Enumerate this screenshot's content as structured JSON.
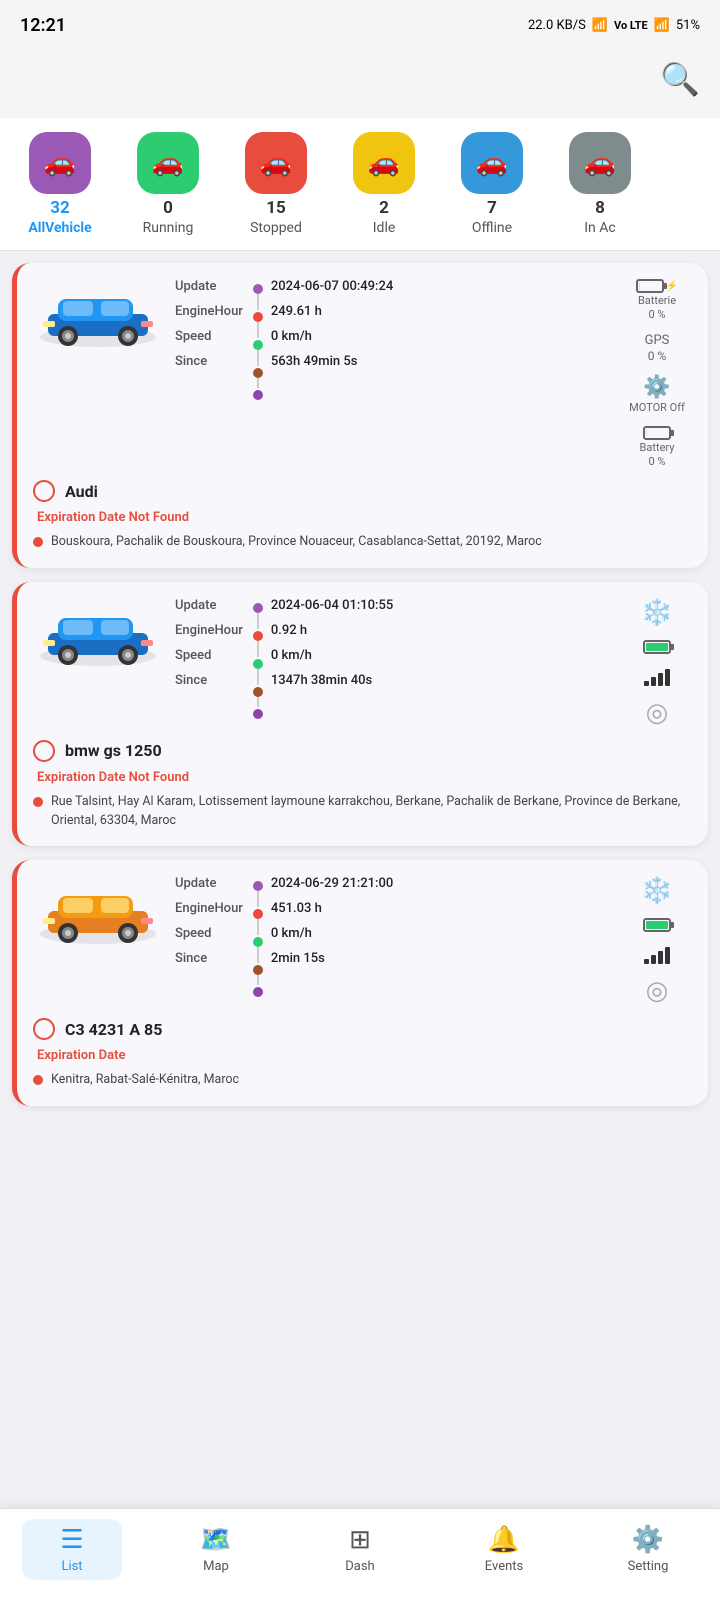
{
  "statusBar": {
    "time": "12:21",
    "network": "22.0 KB/S",
    "battery": "51%"
  },
  "header": {
    "searchLabel": "Search"
  },
  "filterTabs": [
    {
      "id": "all",
      "cssClass": "tab-all",
      "count": "32",
      "label": "AllVehicle",
      "active": true
    },
    {
      "id": "running",
      "cssClass": "tab-running",
      "count": "0",
      "label": "Running",
      "active": false
    },
    {
      "id": "stopped",
      "cssClass": "tab-stopped",
      "count": "15",
      "label": "Stopped",
      "active": false
    },
    {
      "id": "idle",
      "cssClass": "tab-idle",
      "count": "2",
      "label": "Idle",
      "active": false
    },
    {
      "id": "offline",
      "cssClass": "tab-offline",
      "count": "7",
      "label": "Offline",
      "active": false
    },
    {
      "id": "inactive",
      "cssClass": "tab-inactive",
      "count": "8",
      "label": "In Ac",
      "active": false
    }
  ],
  "vehicles": [
    {
      "id": "audi",
      "name": "Audi",
      "carColor": "#1a6fc4",
      "update": "2024-06-07 00:49:24",
      "engineHour": "249.61 h",
      "speed": "0 km/h",
      "since": "563h 49min 5s",
      "batterie": "Batterie",
      "batterieVal": "0 %",
      "gps": "GPS",
      "gpsVal": "0 %",
      "motorStatus": "MOTOR Off",
      "batteryVal2": "0 %",
      "expiryText": "Expiration Date Not Found",
      "address": "Bouskoura, Pachalik de Bouskoura, Province Nouaceur, Casablanca-Settat, 20192, Maroc",
      "hasSnow": false,
      "hasBatteryFull": false,
      "hasSignal": false,
      "hasTarget": false
    },
    {
      "id": "bmwgs",
      "name": "bmw gs 1250",
      "carColor": "#1a6fc4",
      "update": "2024-06-04 01:10:55",
      "engineHour": "0.92 h",
      "speed": "0 km/h",
      "since": "1347h 38min 40s",
      "expiryText": "Expiration Date Not Found",
      "address": "Rue Talsint, Hay Al Karam, Lotissement laymoune karrakchou, Berkane, Pachalik de Berkane, Province de Berkane, Oriental, 63304, Maroc",
      "hasSnow": true,
      "hasBatteryFull": true,
      "hasSignal": true,
      "hasTarget": true
    },
    {
      "id": "c3",
      "name": "C3 4231 A 85",
      "carColor": "#f39c12",
      "update": "2024-06-29 21:21:00",
      "engineHour": "451.03 h",
      "speed": "0 km/h",
      "since": "2min 15s",
      "expiryText": "Expiration Date",
      "address": "Kenitra, Rabat-Salé-Kénitra, Maroc",
      "hasSnow": true,
      "hasBatteryFull": true,
      "hasSignal": true,
      "hasTarget": true
    }
  ],
  "nav": {
    "items": [
      {
        "id": "list",
        "icon": "☰",
        "label": "List",
        "active": true
      },
      {
        "id": "map",
        "icon": "🗺",
        "label": "Map",
        "active": false
      },
      {
        "id": "dash",
        "icon": "⊞",
        "label": "Dash",
        "active": false
      },
      {
        "id": "events",
        "icon": "🔔",
        "label": "Events",
        "active": false
      },
      {
        "id": "setting",
        "icon": "⚙",
        "label": "Setting",
        "active": false
      }
    ]
  }
}
